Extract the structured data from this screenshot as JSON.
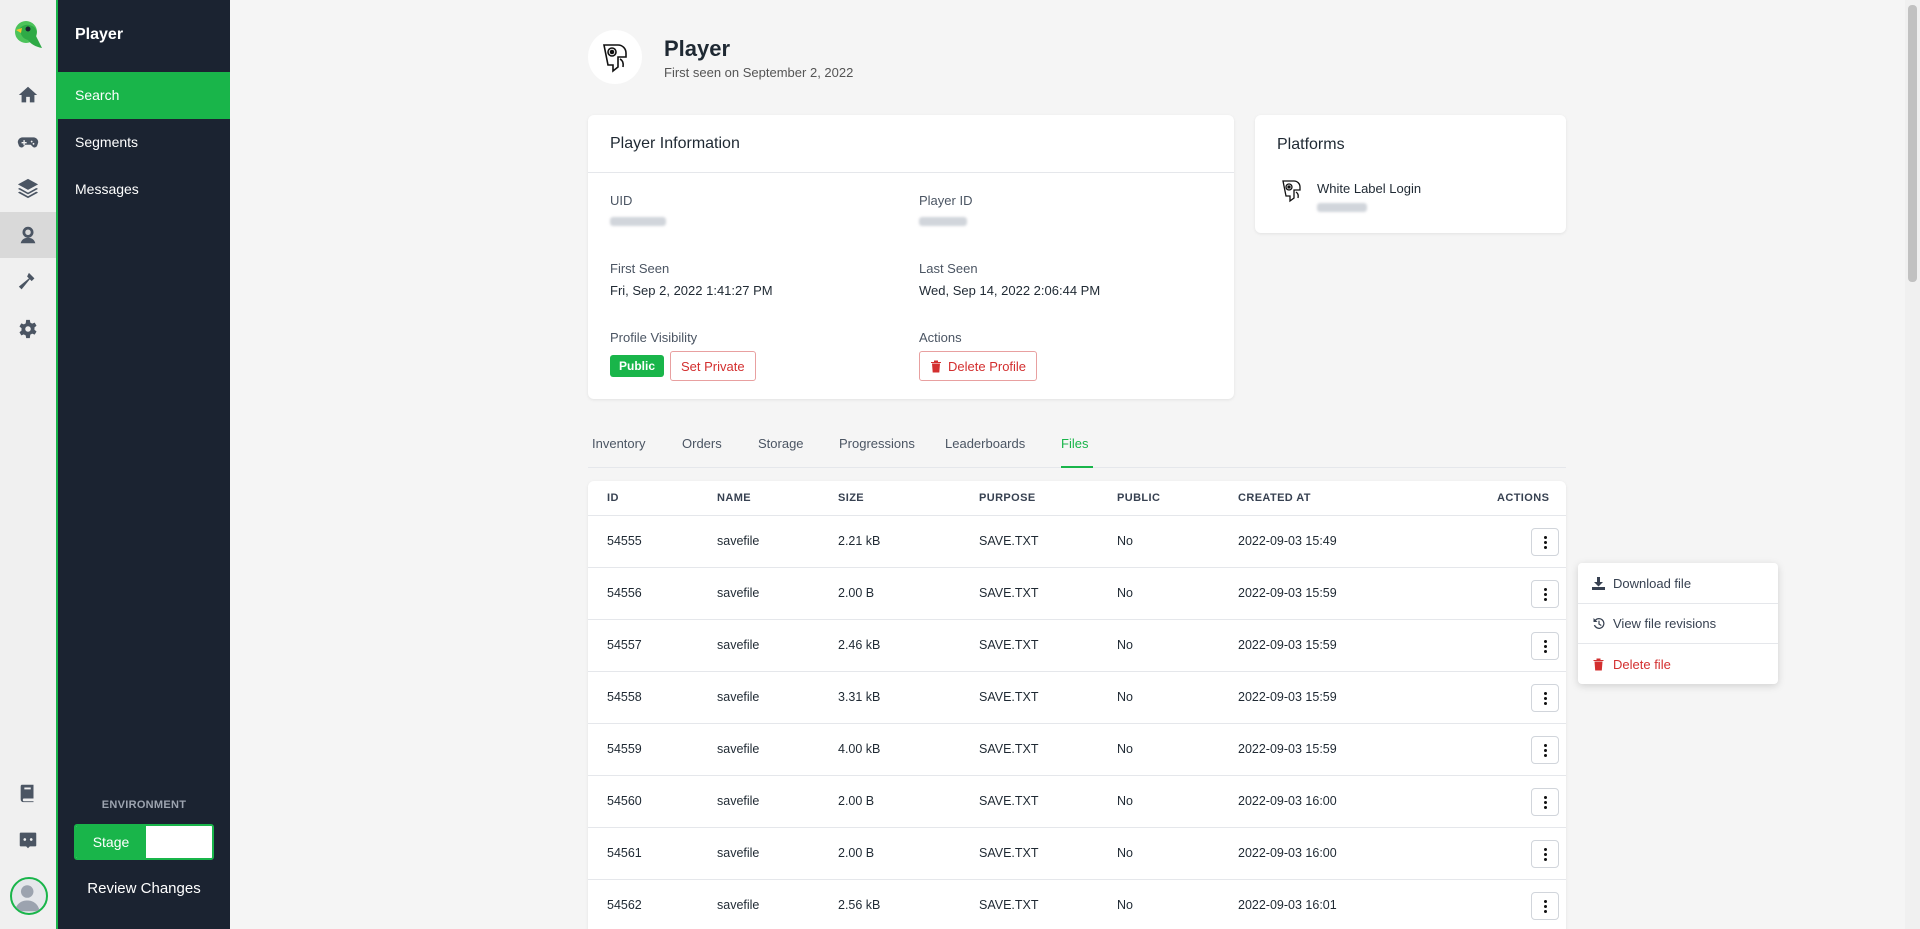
{
  "sidebar": {
    "section_title": "Player",
    "items": [
      {
        "label": "Search",
        "active": true
      },
      {
        "label": "Segments"
      },
      {
        "label": "Messages"
      }
    ],
    "environment_label": "ENVIRONMENT",
    "environment_value": "Stage",
    "review_changes": "Review Changes"
  },
  "rail_icons": [
    "home-icon",
    "gamepad-icon",
    "layers-icon",
    "player-icon",
    "hammer-icon",
    "gear-icon",
    "book-icon",
    "discord-icon"
  ],
  "player": {
    "name": "Player",
    "first_seen_text": "First seen on September 2, 2022"
  },
  "info": {
    "title": "Player Information",
    "uid_label": "UID",
    "player_id_label": "Player ID",
    "first_seen_label": "First Seen",
    "first_seen_value": "Fri, Sep 2, 2022 1:41:27 PM",
    "last_seen_label": "Last Seen",
    "last_seen_value": "Wed, Sep 14, 2022 2:06:44 PM",
    "visibility_label": "Profile Visibility",
    "visibility_value": "Public",
    "set_private": "Set Private",
    "actions_label": "Actions",
    "delete_profile": "Delete Profile"
  },
  "platforms": {
    "title": "Platforms",
    "items": [
      {
        "name": "White Label Login"
      }
    ]
  },
  "tabs": [
    "Inventory",
    "Orders",
    "Storage",
    "Progressions",
    "Leaderboards",
    "Files"
  ],
  "active_tab": "Files",
  "table": {
    "headers": [
      "ID",
      "NAME",
      "SIZE",
      "PURPOSE",
      "PUBLIC",
      "CREATED AT",
      "ACTIONS"
    ],
    "rows": [
      [
        "54555",
        "savefile",
        "2.21 kB",
        "SAVE.TXT",
        "No",
        "2022-09-03 15:49"
      ],
      [
        "54556",
        "savefile",
        "2.00 B",
        "SAVE.TXT",
        "No",
        "2022-09-03 15:59"
      ],
      [
        "54557",
        "savefile",
        "2.46 kB",
        "SAVE.TXT",
        "No",
        "2022-09-03 15:59"
      ],
      [
        "54558",
        "savefile",
        "3.31 kB",
        "SAVE.TXT",
        "No",
        "2022-09-03 15:59"
      ],
      [
        "54559",
        "savefile",
        "4.00 kB",
        "SAVE.TXT",
        "No",
        "2022-09-03 15:59"
      ],
      [
        "54560",
        "savefile",
        "2.00 B",
        "SAVE.TXT",
        "No",
        "2022-09-03 16:00"
      ],
      [
        "54561",
        "savefile",
        "2.00 B",
        "SAVE.TXT",
        "No",
        "2022-09-03 16:00"
      ],
      [
        "54562",
        "savefile",
        "2.56 kB",
        "SAVE.TXT",
        "No",
        "2022-09-03 16:01"
      ]
    ]
  },
  "row_menu": {
    "download": "Download file",
    "revisions": "View file revisions",
    "delete": "Delete file"
  },
  "colors": {
    "accent": "#19b54a",
    "sidebar_bg": "#1b2331",
    "danger": "#d32f2f"
  }
}
